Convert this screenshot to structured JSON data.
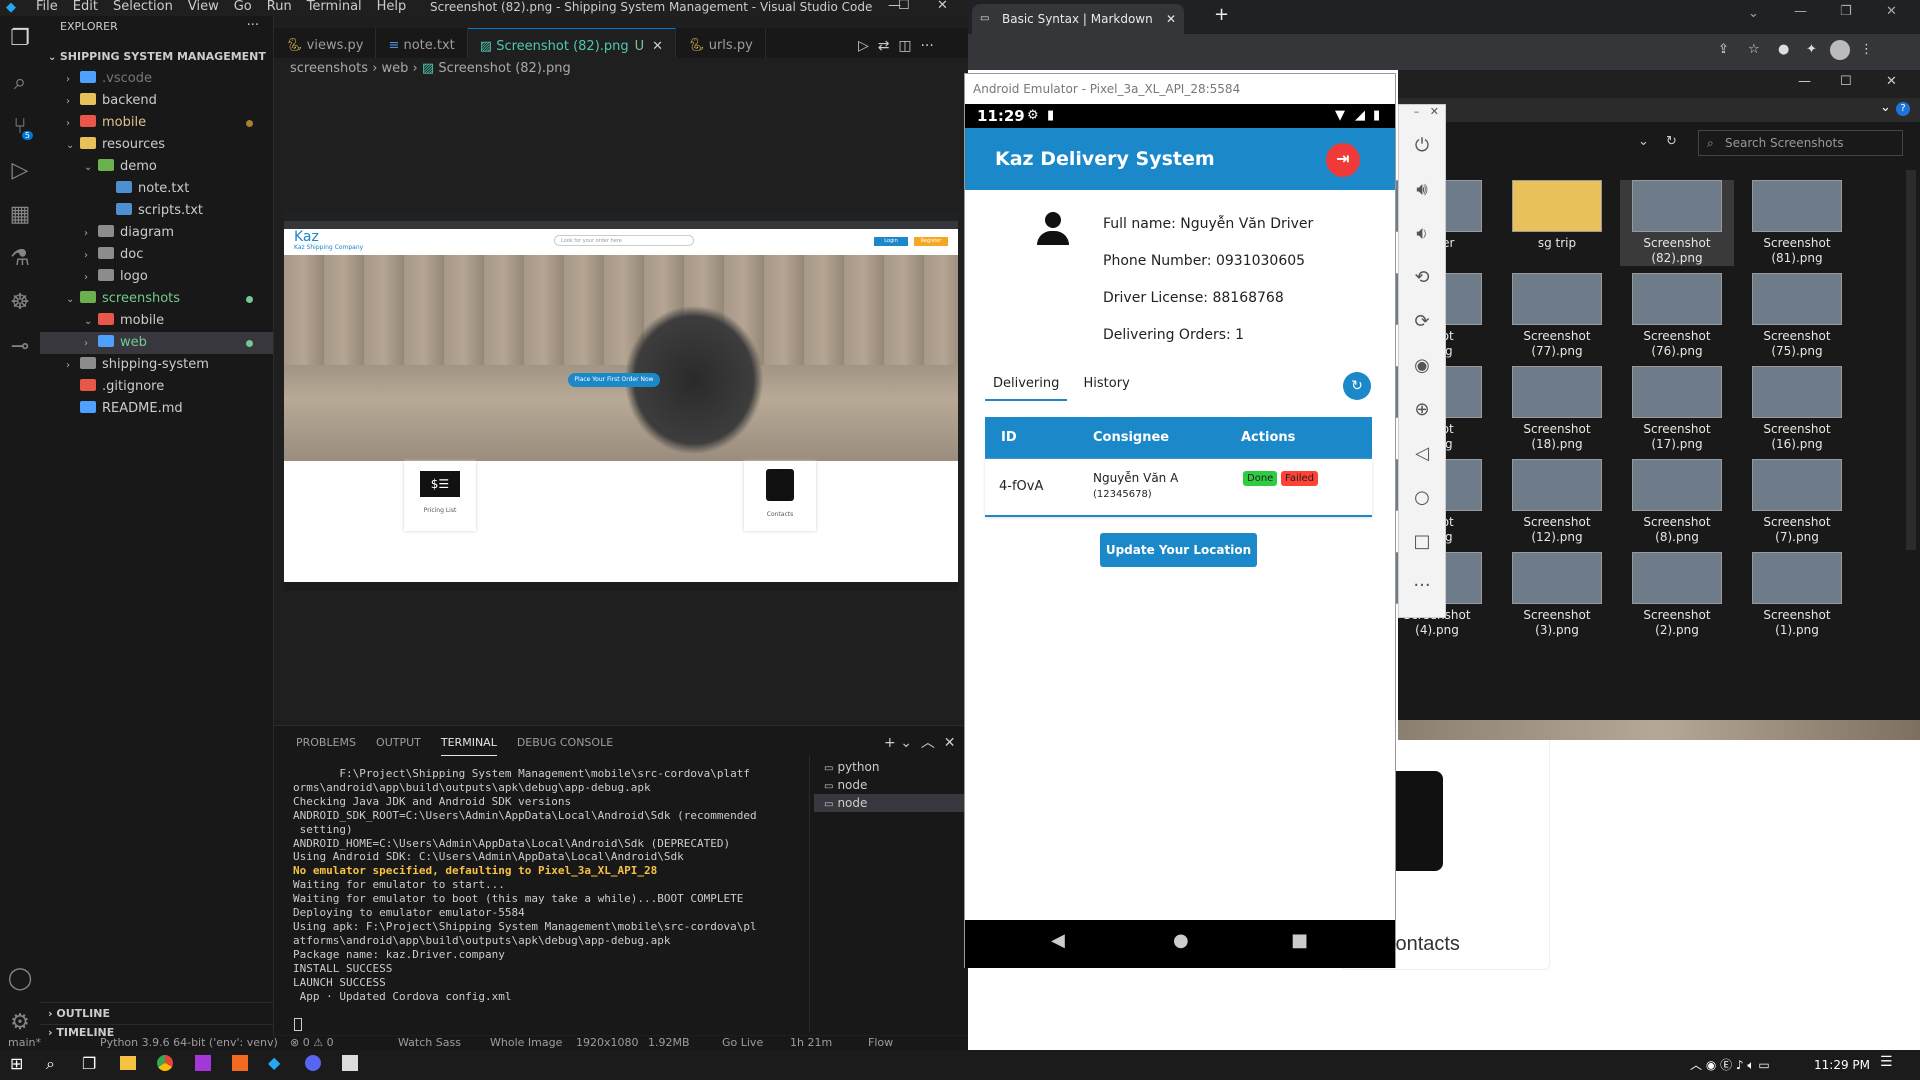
{
  "vscode": {
    "menu": [
      "File",
      "Edit",
      "Selection",
      "View",
      "Go",
      "Run",
      "Terminal",
      "Help"
    ],
    "title": "Screenshot (82).png - Shipping System Management - Visual Studio Code",
    "explorer_label": "EXPLORER",
    "project": "SHIPPING SYSTEM MANAGEMENT",
    "tree": [
      {
        "label": ".vscode",
        "indent": 1,
        "chev": "›",
        "color": "#4ea1ff",
        "dim": true
      },
      {
        "label": "backend",
        "indent": 1,
        "chev": "›",
        "color": "#e8c15a"
      },
      {
        "label": "mobile",
        "indent": 1,
        "chev": "›",
        "color": "#e8574a",
        "text_color": "#e2c08d",
        "dot": "#a6822c"
      },
      {
        "label": "resources",
        "indent": 1,
        "chev": "⌄",
        "color": "#e8c15a"
      },
      {
        "label": "demo",
        "indent": 2,
        "chev": "⌄",
        "color": "#6ab04c"
      },
      {
        "label": "note.txt",
        "indent": 3,
        "chev": "",
        "color": "#4e8fd1"
      },
      {
        "label": "scripts.txt",
        "indent": 3,
        "chev": "",
        "color": "#4e8fd1"
      },
      {
        "label": "diagram",
        "indent": 2,
        "chev": "›",
        "color": "#8c8c8c"
      },
      {
        "label": "doc",
        "indent": 2,
        "chev": "›",
        "color": "#8c8c8c"
      },
      {
        "label": "logo",
        "indent": 2,
        "chev": "›",
        "color": "#8c8c8c"
      },
      {
        "label": "screenshots",
        "indent": 1,
        "chev": "⌄",
        "color": "#6ab04c",
        "text_color": "#73c991",
        "dot": "#73c991"
      },
      {
        "label": "mobile",
        "indent": 2,
        "chev": "⌄",
        "color": "#e8574a"
      },
      {
        "label": "web",
        "indent": 2,
        "chev": "›",
        "color": "#4ea1ff",
        "text_color": "#73c991",
        "dot": "#73c991",
        "selected": true
      },
      {
        "label": "shipping-system",
        "indent": 1,
        "chev": "›",
        "color": "#8c8c8c"
      },
      {
        "label": ".gitignore",
        "indent": 1,
        "chev": "",
        "color": "#e8574a"
      },
      {
        "label": "README.md",
        "indent": 1,
        "chev": "",
        "color": "#4ea1ff"
      }
    ],
    "outline": "OUTLINE",
    "timeline": "TIMELINE",
    "tabs": [
      {
        "label": "views.py",
        "active": false
      },
      {
        "label": "note.txt",
        "active": false
      },
      {
        "label": "Screenshot (82).png",
        "active": true,
        "badge": "U"
      },
      {
        "label": "urls.py",
        "active": false
      }
    ],
    "breadcrumb": [
      "screenshots",
      "web",
      "Screenshot (82).png"
    ],
    "panel_tabs": [
      "PROBLEMS",
      "OUTPUT",
      "TERMINAL",
      "DEBUG CONSOLE"
    ],
    "terminal_lines": [
      {
        "text": "       F:\\Project\\Shipping System Management\\mobile\\src-cordova\\platf",
        "color": "#cccccc"
      },
      {
        "text": "orms\\android\\app\\build\\outputs\\apk\\debug\\app-debug.apk",
        "color": "#cccccc"
      },
      {
        "text": "Checking Java JDK and Android SDK versions",
        "color": "#cccccc"
      },
      {
        "text": "ANDROID_SDK_ROOT=C:\\Users\\Admin\\AppData\\Local\\Android\\Sdk (recommended",
        "color": "#cccccc"
      },
      {
        "text": " setting)",
        "color": "#cccccc"
      },
      {
        "text": "ANDROID_HOME=C:\\Users\\Admin\\AppData\\Local\\Android\\Sdk (DEPRECATED)",
        "color": "#cccccc"
      },
      {
        "text": "Using Android SDK: C:\\Users\\Admin\\AppData\\Local\\Android\\Sdk",
        "color": "#cccccc"
      },
      {
        "text": "No emulator specified, defaulting to Pixel_3a_XL_API_28",
        "color": "#f5c242",
        "bold": true
      },
      {
        "text": "Waiting for emulator to start...",
        "color": "#cccccc"
      },
      {
        "text": "Waiting for emulator to boot (this may take a while)...BOOT COMPLETE",
        "color": "#cccccc"
      },
      {
        "text": "Deploying to emulator emulator-5584",
        "color": "#cccccc"
      },
      {
        "text": "Using apk: F:\\Project\\Shipping System Management\\mobile\\src-cordova\\pl",
        "color": "#cccccc"
      },
      {
        "text": "atforms\\android\\app\\build\\outputs\\apk\\debug\\app-debug.apk",
        "color": "#cccccc"
      },
      {
        "text": "Package name: kaz.Driver.company",
        "color": "#cccccc"
      },
      {
        "text": "INSTALL SUCCESS",
        "color": "#cccccc"
      },
      {
        "text": "LAUNCH SUCCESS",
        "color": "#cccccc"
      },
      {
        "text": "",
        "color": "#cccccc"
      },
      {
        "text": " App · Updated Cordova config.xml",
        "color": "#cccccc"
      }
    ],
    "term_list": [
      "python",
      "node",
      "node"
    ],
    "status": [
      "main*",
      "Python 3.9.6 64-bit ('env': venv)",
      "⊗ 0 ⚠ 0",
      "Watch Sass",
      "Whole Image",
      "1920x1080",
      "1.92MB",
      "Go Live",
      "1h 21m",
      "Flow"
    ]
  },
  "preview": {
    "logo": "Kaz",
    "logo_sub": "Kaz Shipping Company",
    "search_placeholder": "Look for your order here",
    "login": "Login",
    "register": "Register",
    "cta": "Place Your First Order Now",
    "card1": "Pricing List",
    "card2": "Contacts"
  },
  "browser": {
    "tab_title": "Basic Syntax | Markdown Guide",
    "contacts_label": "Contacts"
  },
  "explorer": {
    "search": "Search Screenshots",
    "items": [
      [
        "paper",
        "sg trip",
        "Screenshot\n(82).png",
        "Screenshot\n(81).png"
      ],
      [
        "nshot\n).png",
        "Screenshot\n(77).png",
        "Screenshot\n(76).png",
        "Screenshot\n(75).png"
      ],
      [
        "nshot\n).png",
        "Screenshot\n(18).png",
        "Screenshot\n(17).png",
        "Screenshot\n(16).png"
      ],
      [
        "nshot\n).png",
        "Screenshot\n(12).png",
        "Screenshot\n(8).png",
        "Screenshot\n(7).png"
      ],
      [
        "Screenshot\n(4).png",
        "Screenshot\n(3).png",
        "Screenshot\n(2).png",
        "Screenshot\n(1).png"
      ]
    ]
  },
  "emulator": {
    "title": "Android Emulator - Pixel_3a_XL_API_28:5584",
    "time": "11:29",
    "app_title": "Kaz Delivery System",
    "full_name": "Full name: Nguyễn Văn Driver",
    "phone": "Phone Number: 0931030605",
    "license": "Driver License: 88168768",
    "delivering": "Delivering Orders: 1",
    "tabs": [
      "Delivering",
      "History"
    ],
    "headers": [
      "ID",
      "Consignee",
      "Actions"
    ],
    "row": {
      "id": "4-fOvA",
      "name": "Nguyễn Văn A",
      "phone": "(12345678)",
      "done": "Done",
      "failed": "Failed"
    },
    "update_btn": "Update Your Location"
  },
  "taskbar": {
    "time": "11:29 PM"
  },
  "colors": {
    "accent": "#1b88c9",
    "done": "#2ecc40",
    "failed": "#ff4136",
    "vs_blue": "#0078d4"
  }
}
